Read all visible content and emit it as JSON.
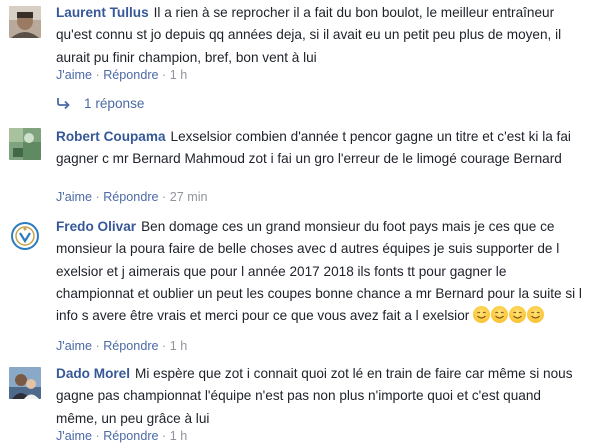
{
  "comments": [
    {
      "author": "Laurent Tullus",
      "text": "Il a rien à se reprocher il a fait du bon boulot, le meilleur entraîneur qu'est connu st jo depuis qq années deja, si il avait eu un petit peu plus de moyen, il aurait pu finir champion, bref, bon vent à lui",
      "like_label": "J'aime",
      "reply_label": "Répondre",
      "time": "1 h",
      "replies": "1 réponse",
      "avatar_icon": "user-avatar"
    },
    {
      "author": "Robert Coupama",
      "text": "Lexselsior combien d'année t pencor gagne un titre et c'est ki la fai gagner c mr Bernard Mahmoud zot i fai un gro l'erreur de le limogé courage Bernard",
      "like_label": "J'aime",
      "reply_label": "Répondre",
      "time": "27 min",
      "avatar_icon": "user-avatar"
    },
    {
      "author": "Fredo Olivar",
      "text": "Ben domage ces un grand monsieur du foot pays mais je ces que ce monsieur la poura faire de belle choses avec d autres équipes je suis supporter de l exelsior et j aimerais que pour l année 2017 2018 ils fonts tt pour gagner le championnat et oublier un peut les coupes bonne chance a mr Bernard pour la suite si l info s avere être vrais et merci pour ce que vous avez fait a l exelsior",
      "emojis": [
        "smile-emoji",
        "smile-emoji",
        "smile-emoji",
        "smile-emoji"
      ],
      "like_label": "J'aime",
      "reply_label": "Répondre",
      "time": "1 h",
      "avatar_icon": "club-crest-avatar"
    },
    {
      "author": "Dado Morel",
      "text": "Mi espère que zot i connait quoi zot lé en train de faire car même si nous gagne pas championnat l'équipe n'est pas non plus n'importe quoi et c'est quand même, un peu grâce à lui",
      "like_label": "J'aime",
      "reply_label": "Répondre",
      "time": "1 h",
      "avatar_icon": "user-avatar"
    }
  ],
  "colors": {
    "author": "#365899",
    "link": "#4b6aa6",
    "meta": "#90949c",
    "text": "#1d2129"
  }
}
